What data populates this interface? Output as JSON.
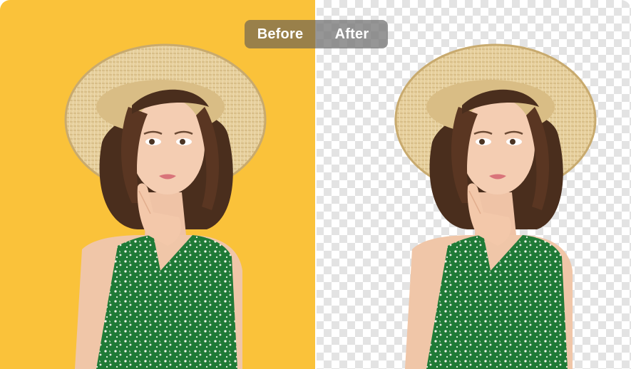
{
  "comparison": {
    "before_label": "Before",
    "after_label": "After",
    "before_background": "#fac23a",
    "after_background": "transparent-checkerboard",
    "subject": "woman-in-straw-hat-and-green-floral-dress"
  }
}
